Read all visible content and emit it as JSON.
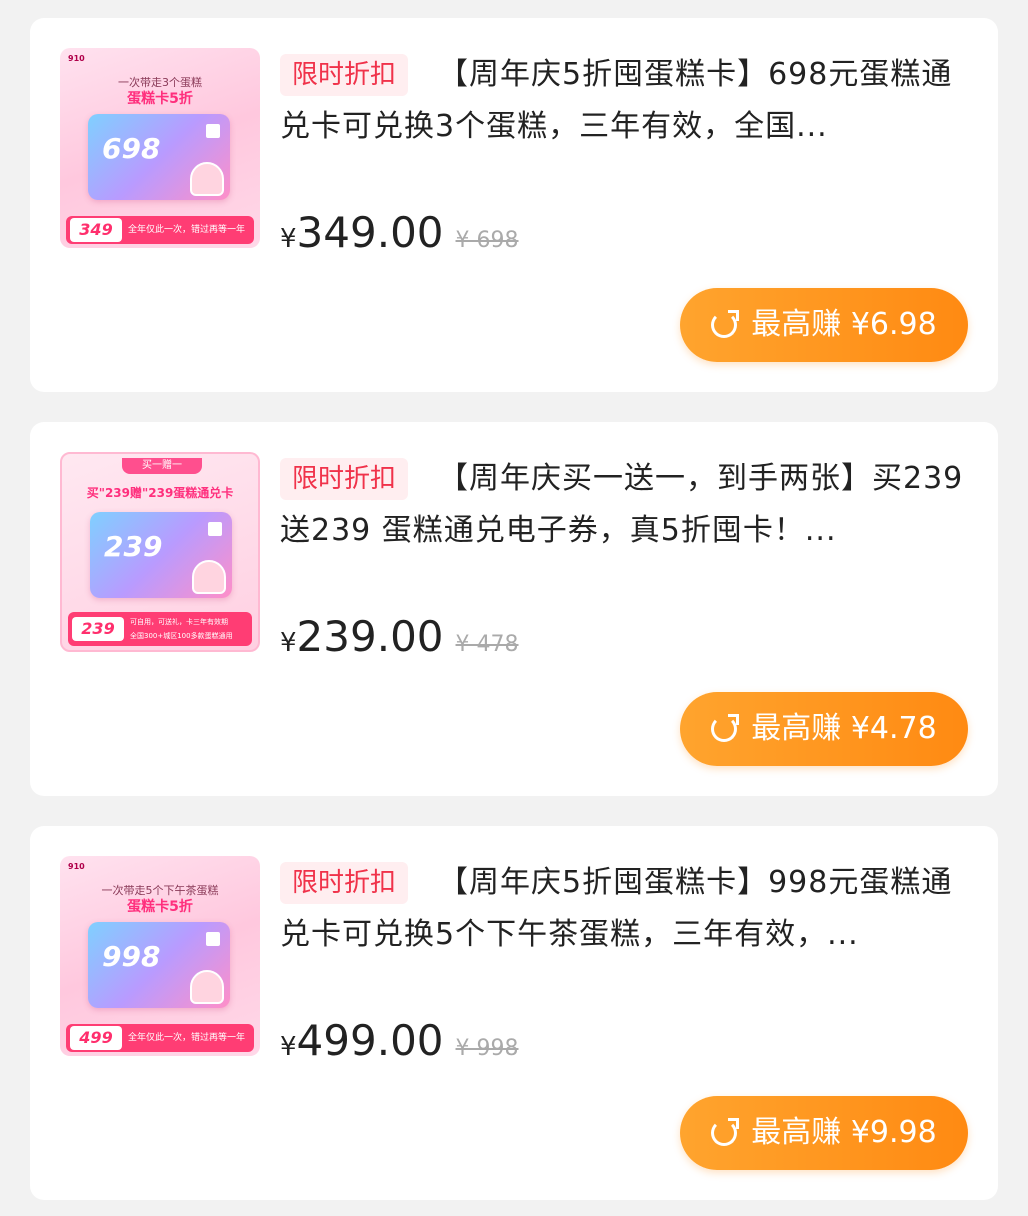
{
  "products": [
    {
      "thumb": {
        "head": "910",
        "line1": "一次带走3个蛋糕",
        "line2": "蛋糕卡5折",
        "ribbon": "",
        "card_number": "698",
        "bar_price": "349",
        "bar_text": "全年仅此一次，错过再等一年",
        "bar_text2": ""
      },
      "badge": "限时折扣",
      "title": "【周年庆5折囤蛋糕卡】698元蛋糕通兑卡可兑换3个蛋糕，三年有效，全国...",
      "price_symbol": "¥",
      "price": "349.00",
      "original_price": "¥ 698",
      "earn_label": "最高赚 ¥6.98"
    },
    {
      "thumb": {
        "head": "",
        "line1": "买一赠一",
        "line2": "买\"239赠\"239蛋糕通兑卡",
        "ribbon": "买一赠一",
        "card_number": "239",
        "bar_price": "239",
        "bar_text": "可自用，可送礼，卡三年有效期",
        "bar_text2": "全国300+城区100多款蛋糕通用"
      },
      "badge": "限时折扣",
      "title": "【周年庆买一送一，到手两张】买239 送239 蛋糕通兑电子券，真5折囤卡！...",
      "price_symbol": "¥",
      "price": "239.00",
      "original_price": "¥ 478",
      "earn_label": "最高赚 ¥4.78"
    },
    {
      "thumb": {
        "head": "910",
        "line1": "一次带走5个下午茶蛋糕",
        "line2": "蛋糕卡5折",
        "ribbon": "",
        "card_number": "998",
        "bar_price": "499",
        "bar_text": "全年仅此一次，错过再等一年",
        "bar_text2": ""
      },
      "badge": "限时折扣",
      "title": "【周年庆5折囤蛋糕卡】998元蛋糕通兑卡可兑换5个下午茶蛋糕，三年有效，...",
      "price_symbol": "¥",
      "price": "499.00",
      "original_price": "¥ 998",
      "earn_label": "最高赚 ¥9.98"
    }
  ],
  "colors": {
    "accent_orange": "#ff9a1f",
    "badge_red": "#f0324a",
    "thumb_pink": "#ff3d74"
  },
  "icons": {
    "earn_icon": "share-arrow-icon"
  }
}
